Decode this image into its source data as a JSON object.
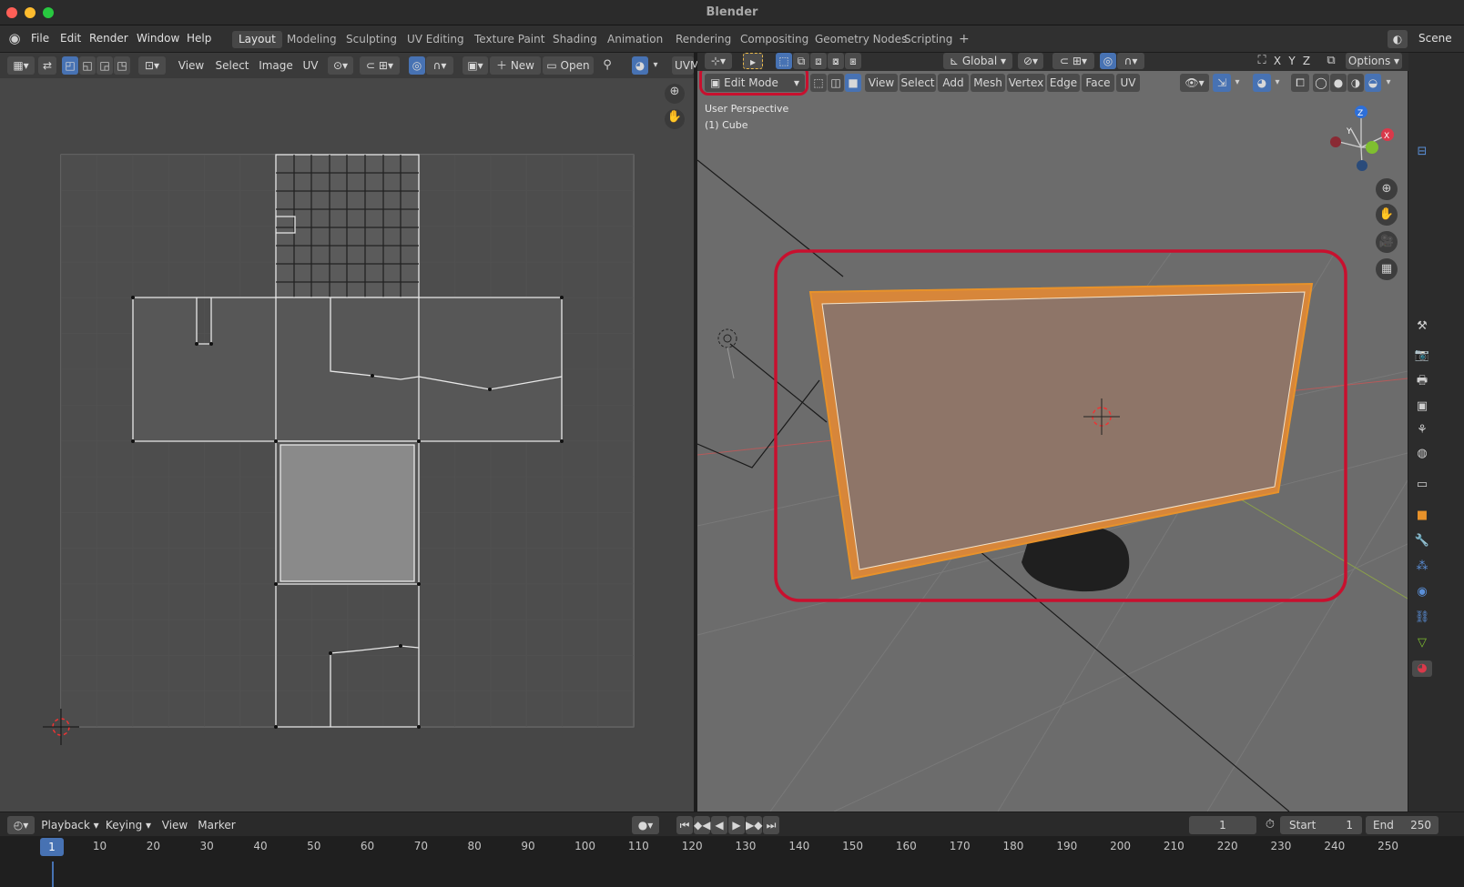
{
  "window": {
    "title": "Blender"
  },
  "menu": [
    "File",
    "Edit",
    "Render",
    "Window",
    "Help"
  ],
  "workspaces": [
    {
      "label": "Layout",
      "active": true
    },
    {
      "label": "Modeling"
    },
    {
      "label": "Sculpting"
    },
    {
      "label": "UV Editing"
    },
    {
      "label": "Texture Paint"
    },
    {
      "label": "Shading"
    },
    {
      "label": "Animation"
    },
    {
      "label": "Rendering"
    },
    {
      "label": "Compositing"
    },
    {
      "label": "Geometry Nodes"
    },
    {
      "label": "Scripting"
    }
  ],
  "add_workspace": "+",
  "scene": "Scene",
  "uv_header": {
    "view": "View",
    "select": "Select",
    "image": "Image",
    "uv": "UV",
    "new": "New",
    "open": "Open",
    "uv_map": "UVM"
  },
  "viewport_header": {
    "transform_orientation": "Global",
    "options": "Options",
    "axes": [
      "X",
      "Y",
      "Z"
    ],
    "mode": "Edit Mode",
    "menus": [
      "View",
      "Select",
      "Add",
      "Mesh",
      "Vertex",
      "Edge",
      "Face",
      "UV"
    ]
  },
  "overlay": {
    "perspective": "User Perspective",
    "object": "(1) Cube"
  },
  "gizmo": {
    "x": "X",
    "y": "Y",
    "z": "Z"
  },
  "timeline": {
    "playback": "Playback",
    "keying": "Keying",
    "view": "View",
    "marker": "Marker",
    "current_frame": "1",
    "start_label": "Start",
    "start": "1",
    "end_label": "End",
    "end": "250",
    "frame_indicator": "1",
    "ticks": [
      "10",
      "20",
      "30",
      "40",
      "50",
      "60",
      "70",
      "80",
      "90",
      "100",
      "110",
      "120",
      "130",
      "140",
      "150",
      "160",
      "170",
      "180",
      "190",
      "200",
      "210",
      "220",
      "230",
      "240",
      "250"
    ]
  },
  "colors": {
    "accent": "#4772b3",
    "highlight": "#c8102e",
    "selection": "#e8922a"
  }
}
